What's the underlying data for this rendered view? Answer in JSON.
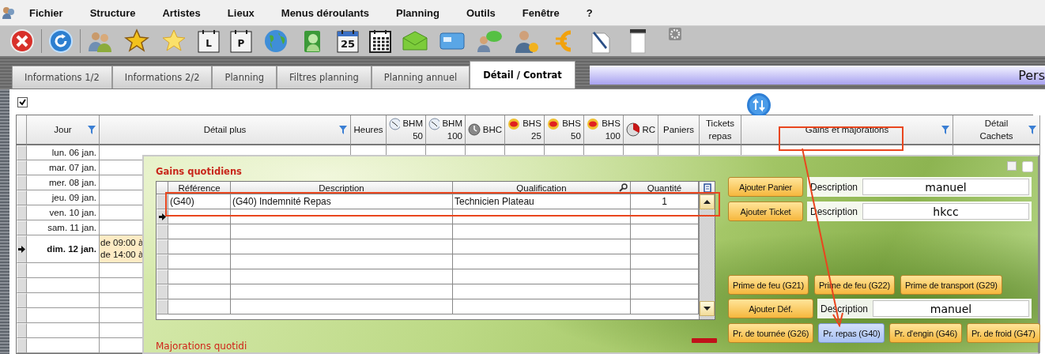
{
  "menu": {
    "items": [
      "Fichier",
      "Structure",
      "Artistes",
      "Lieux",
      "Menus déroulants",
      "Planning",
      "Outils",
      "Fenêtre",
      "?"
    ]
  },
  "toolbar": [
    {
      "kind": "close"
    },
    {
      "kind": "refresh"
    },
    {
      "kind": "people"
    },
    {
      "kind": "badge-star"
    },
    {
      "kind": "star"
    },
    {
      "kind": "calendar-letter",
      "text": "L"
    },
    {
      "kind": "calendar-letter",
      "text": "P"
    },
    {
      "kind": "globe"
    },
    {
      "kind": "person-search"
    },
    {
      "kind": "calendar-date",
      "text": "25"
    },
    {
      "kind": "calendar-grid"
    },
    {
      "kind": "envelope"
    },
    {
      "kind": "card"
    },
    {
      "kind": "chat-person"
    },
    {
      "kind": "person-euro"
    },
    {
      "kind": "euro"
    },
    {
      "kind": "pen-document"
    },
    {
      "kind": "printer"
    },
    {
      "kind": "gear"
    }
  ],
  "tabs": [
    {
      "label": "Informations 1/2",
      "selected": false
    },
    {
      "label": "Informations 2/2",
      "selected": false
    },
    {
      "label": "Planning",
      "selected": false
    },
    {
      "label": "Filtres planning",
      "selected": false
    },
    {
      "label": "Planning annuel",
      "selected": false
    },
    {
      "label": "Détail / Contrat",
      "selected": true
    }
  ],
  "banner": {
    "text": "Pers"
  },
  "show_all": {
    "checked": true
  },
  "grid": {
    "columns": [
      {
        "label": "Jour",
        "filter": true,
        "kind": "text"
      },
      {
        "label": "Détail plus",
        "filter": true,
        "kind": "text"
      },
      {
        "label": "Heures",
        "filter": false,
        "kind": "text"
      },
      {
        "label": "BHM\n50",
        "filter": false,
        "kind": "clock"
      },
      {
        "label": "BHM\n100",
        "filter": false,
        "kind": "clock"
      },
      {
        "label": "BHC",
        "filter": false,
        "kind": "gauge"
      },
      {
        "label": "BHS\n25",
        "filter": false,
        "kind": "coin"
      },
      {
        "label": "BHS\n50",
        "filter": false,
        "kind": "coin"
      },
      {
        "label": "BHS\n100",
        "filter": false,
        "kind": "coin"
      },
      {
        "label": "RC",
        "filter": false,
        "kind": "pie"
      },
      {
        "label": "Paniers",
        "filter": false,
        "kind": "text"
      },
      {
        "label": "Tickets\nrepas",
        "filter": false,
        "kind": "text"
      },
      {
        "label": "Gains et majorations",
        "filter": true,
        "kind": "text"
      },
      {
        "label": "Détail\nCachets",
        "filter": true,
        "kind": "text"
      }
    ],
    "rows": [
      {
        "day": "lun. 06 jan.",
        "selected": false
      },
      {
        "day": "mar. 07 jan.",
        "selected": false
      },
      {
        "day": "mer. 08 jan.",
        "selected": false
      },
      {
        "day": "jeu. 09 jan.",
        "selected": false
      },
      {
        "day": "ven. 10 jan.",
        "selected": false
      },
      {
        "day": "sam. 11 jan.",
        "selected": false
      },
      {
        "day": "dim. 12 jan.",
        "selected": true,
        "details": [
          "de 09:00 à",
          "de 14:00 à"
        ]
      }
    ]
  },
  "panel": {
    "title": "Gains quotidiens",
    "columns": [
      {
        "label": "Référence",
        "search": false
      },
      {
        "label": "Description",
        "search": false
      },
      {
        "label": "Qualification",
        "search": true
      },
      {
        "label": "Quantité",
        "search": false
      }
    ],
    "rows": [
      {
        "current": false,
        "cells": [
          "(G40)",
          "(G40) Indemnité Repas",
          "Technicien Plateau",
          "1"
        ]
      },
      {
        "current": true
      },
      {
        "current": false
      },
      {
        "current": false
      },
      {
        "current": false
      },
      {
        "current": false
      },
      {
        "current": false
      },
      {
        "current": false
      }
    ],
    "entries": [
      {
        "button": "Ajouter Panier",
        "label": "Description",
        "value": "manuel"
      },
      {
        "button": "Ajouter Ticket",
        "label": "Description",
        "value": "hkcc"
      }
    ],
    "primes": [
      "Prime de feu (G21)",
      "Prime de feu (G22)",
      "Prime de transport (G29)"
    ],
    "default_entry": {
      "button": "Ajouter Déf.",
      "label": "Description",
      "value": "manuel"
    },
    "shortcuts": [
      {
        "label": "Pr. de tournée (G26)",
        "selected": false
      },
      {
        "label": "Pr. repas (G40)",
        "selected": true
      },
      {
        "label": "Pr. d'engin (G46)",
        "selected": false
      },
      {
        "label": "Pr. de froid (G47)",
        "selected": false
      }
    ]
  },
  "next_section": {
    "title": "Majorations quotidi"
  }
}
